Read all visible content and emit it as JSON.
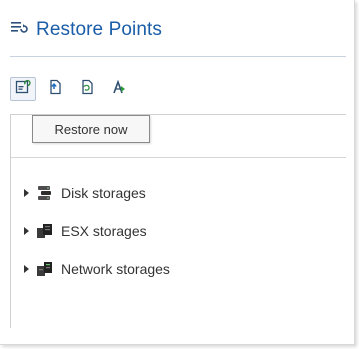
{
  "panel": {
    "title": "Restore Points",
    "title_icon": "restore-points-list-icon",
    "accent_color": "#1a5da8"
  },
  "toolbar": {
    "buttons": [
      {
        "icon": "restore-now-icon",
        "tooltip": "Restore now",
        "active": true
      },
      {
        "icon": "restore-file-icon"
      },
      {
        "icon": "restore-backup-icon"
      },
      {
        "icon": "export-restore-icon"
      }
    ]
  },
  "tooltip": {
    "text": "Restore now"
  },
  "tree": {
    "items": [
      {
        "label": "Disk storages",
        "icon": "disk-storage-icon"
      },
      {
        "label": "ESX storages",
        "icon": "esx-storage-icon"
      },
      {
        "label": "Network storages",
        "icon": "network-storage-icon"
      }
    ]
  }
}
